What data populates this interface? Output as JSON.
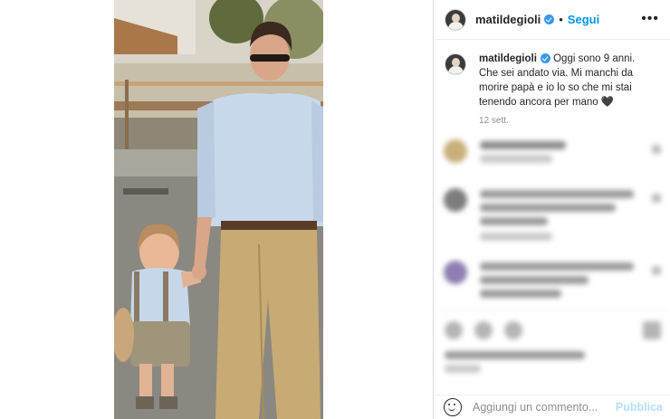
{
  "post": {
    "username": "matildegioli",
    "follow_label": "Segui",
    "more_label": "•••",
    "dot": "•"
  },
  "caption": {
    "username": "matildegioli",
    "text": "Oggi sono 9 anni. Che sei andato via. Mi manchi da morire papà e io lo so che mi stai tenendo ancora per mano 🖤",
    "timestamp": "12 sett."
  },
  "comment_box": {
    "placeholder": "Aggiungi un commento...",
    "publish_label": "Pubblica"
  },
  "icons": {
    "verified": "verified-badge-icon",
    "emoji": "emoji-icon",
    "more": "more-options-icon"
  },
  "colors": {
    "accent": "#0095f6",
    "verified": "#3897f0",
    "publish_disabled": "#b2dffc"
  }
}
